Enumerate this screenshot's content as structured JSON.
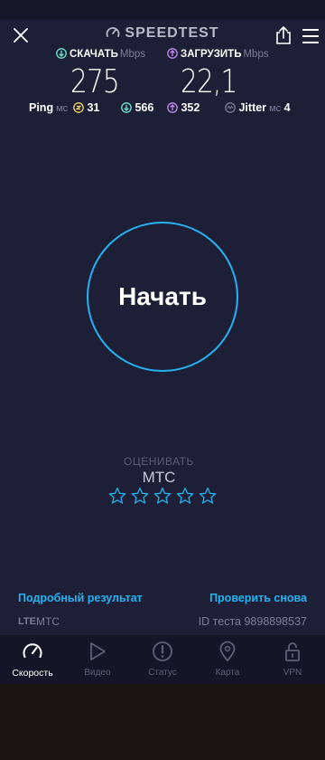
{
  "app": {
    "brand": "SPEEDTEST"
  },
  "download": {
    "label": "СКАЧАТЬ",
    "unit": "Mbps",
    "value": "275"
  },
  "upload": {
    "label": "ЗАГРУЗИТЬ",
    "unit": "Mbps",
    "value": "22,1"
  },
  "ping": {
    "label": "Ping",
    "unit": "мс",
    "idle": "31",
    "download": "566",
    "upload": "352"
  },
  "jitter": {
    "label": "Jitter",
    "unit": "мс",
    "value": "4"
  },
  "go_button": {
    "label": "Начать"
  },
  "rating": {
    "prompt": "ОЦЕНИВАТЬ",
    "provider": "МТС",
    "stars_total": 5,
    "stars_filled": 0
  },
  "footer": {
    "detail_link": "Подробный результат",
    "retry_link": "Проверить снова",
    "connection_type": "LTE",
    "connection_provider": "МТС",
    "test_id": "ID теста 9898898537"
  },
  "nav": [
    {
      "label": "Скорость",
      "icon": "speedometer-icon",
      "active": true
    },
    {
      "label": "Видео",
      "icon": "play-icon",
      "active": false
    },
    {
      "label": "Статус",
      "icon": "alert-icon",
      "active": false
    },
    {
      "label": "Карта",
      "icon": "map-pin-icon",
      "active": false
    },
    {
      "label": "VPN",
      "icon": "lock-icon",
      "active": false
    }
  ],
  "colors": {
    "background": "#1d1f36",
    "accent": "#23b3f2",
    "download_icon": "#6ee7d2",
    "upload_icon": "#c58cf2",
    "ping_icon": "#f2d35c"
  }
}
